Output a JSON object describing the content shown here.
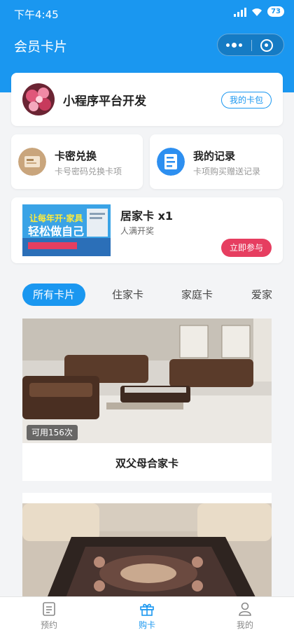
{
  "status_bar": {
    "time": "下午4:45",
    "battery": "73"
  },
  "nav": {
    "title": "会员卡片"
  },
  "profile": {
    "name": "小程序平台开发",
    "my_card_button": "我的卡包"
  },
  "features": [
    {
      "title": "卡密兑换",
      "subtitle": "卡号密码兑换卡项",
      "icon": "card-redeem-icon"
    },
    {
      "title": "我的记录",
      "subtitle": "卡项购买赠送记录",
      "icon": "record-icon"
    }
  ],
  "promo": {
    "title": "居家卡 x1",
    "subtitle": "人满开奖",
    "button": "立即参与",
    "thumb_text_main": "轻松做自己",
    "thumb_text_top": "让每年开·家具"
  },
  "tabs": [
    "所有卡片",
    "住家卡",
    "家庭卡",
    "爱家"
  ],
  "cards": [
    {
      "title": "双父母合家卡",
      "badge": "可用156次"
    },
    {
      "title": "",
      "badge": ""
    }
  ],
  "tabbar": [
    {
      "label": "预约",
      "icon": "calendar-doc-icon"
    },
    {
      "label": "购卡",
      "icon": "gift-icon"
    },
    {
      "label": "我的",
      "icon": "user-icon"
    }
  ],
  "colors": {
    "primary": "#1a97f0",
    "accent": "#e63e60",
    "background": "#f3f4f6"
  }
}
